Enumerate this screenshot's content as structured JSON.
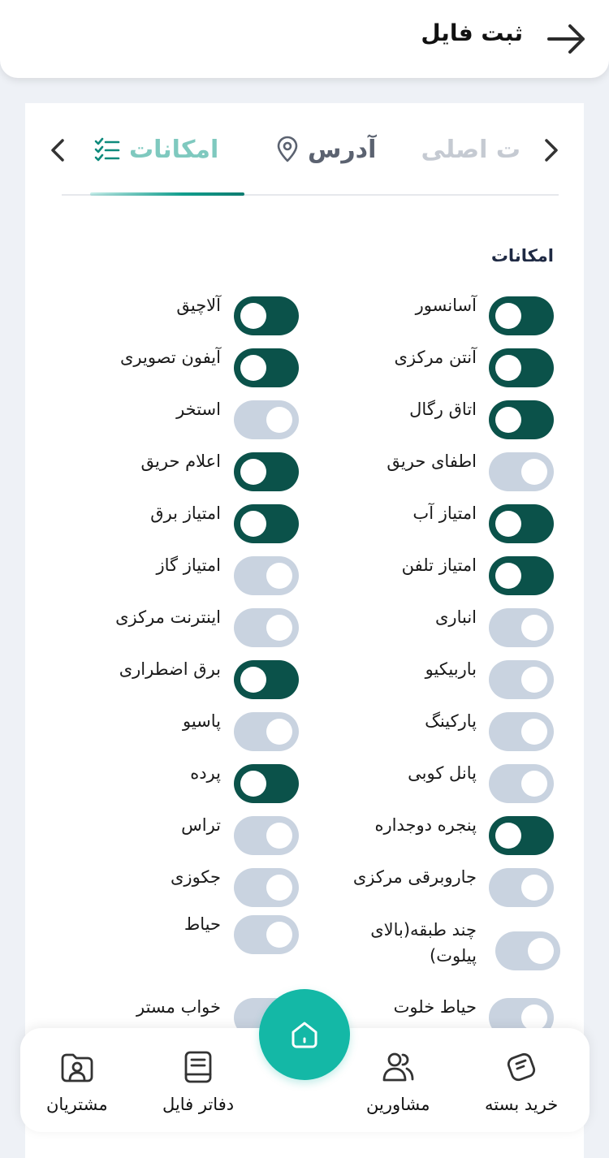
{
  "header": {
    "title": "ثبت فایل"
  },
  "tabs": {
    "main": "ت اصلی",
    "address": "آدرس",
    "amenities": "امکانات"
  },
  "section": {
    "title": "امکانات"
  },
  "amenities": {
    "right": [
      {
        "label": "آسانسور",
        "on": true
      },
      {
        "label": "آنتن مرکزی",
        "on": true
      },
      {
        "label": "اتاق رگال",
        "on": true
      },
      {
        "label": "اطفای حریق",
        "on": false
      },
      {
        "label": "امتیاز آب",
        "on": true
      },
      {
        "label": "امتیاز تلفن",
        "on": true
      },
      {
        "label": "انباری",
        "on": false
      },
      {
        "label": "باربیکیو",
        "on": false
      },
      {
        "label": "پارکینگ",
        "on": false
      },
      {
        "label": "پانل کوبی",
        "on": false
      },
      {
        "label": "پنجره دوجداره",
        "on": true
      },
      {
        "label": "جاروبرقی مرکزی",
        "on": false
      },
      {
        "label": "چند طبقه(بالای پیلوت)",
        "on": false
      },
      {
        "label": "حیاط خلوت",
        "on": false
      }
    ],
    "left": [
      {
        "label": "آلاچیق",
        "on": true
      },
      {
        "label": "آیفون تصویری",
        "on": true
      },
      {
        "label": "استخر",
        "on": false
      },
      {
        "label": "اعلام حریق",
        "on": true
      },
      {
        "label": "امتیاز برق",
        "on": true
      },
      {
        "label": "امتیاز گاز",
        "on": false
      },
      {
        "label": "اینترنت مرکزی",
        "on": false
      },
      {
        "label": "برق اضطراری",
        "on": true
      },
      {
        "label": "پاسیو",
        "on": false
      },
      {
        "label": "پرده",
        "on": true
      },
      {
        "label": "تراس",
        "on": false
      },
      {
        "label": "جکوزی",
        "on": false
      },
      {
        "label": "حیاط",
        "on": false
      },
      {
        "label": "خواب مستر",
        "on": false
      }
    ]
  },
  "nav": {
    "buy_package": "خرید بسته",
    "advisors": "مشاورین",
    "file_books": "دفاتر فایل",
    "customers": "مشتریان"
  },
  "colors": {
    "toggle_on": "#0b524a",
    "toggle_off": "#c9d3e0",
    "accent": "#14b8a6"
  }
}
